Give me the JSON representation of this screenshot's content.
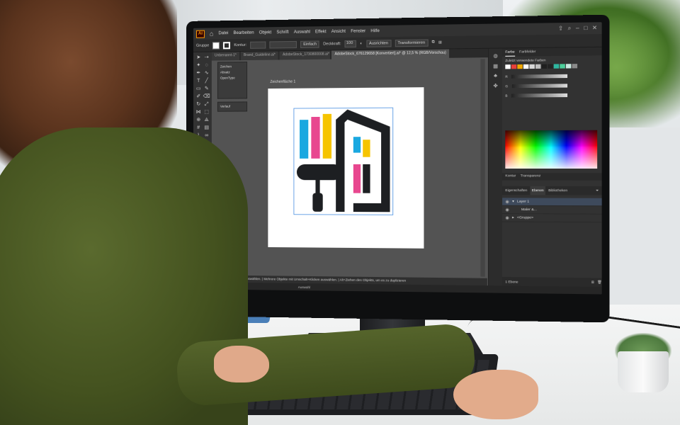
{
  "app": {
    "logo_text": "Ai",
    "menus": [
      "Datei",
      "Bearbeiten",
      "Objekt",
      "Schrift",
      "Auswahl",
      "Effekt",
      "Ansicht",
      "Fenster",
      "Hilfe"
    ]
  },
  "control_bar": {
    "selection_label": "Gruppe",
    "stroke_label": "Kontur:",
    "stroke_style": "Einfach",
    "opacity_label": "Deckkraft:",
    "opacity_value": "100",
    "align_button": "Ausrichten",
    "transform_button": "Transformieren"
  },
  "document_tabs": [
    {
      "label": "Unbenannt-1*",
      "active": false
    },
    {
      "label": "Brand_Guideline.ai*",
      "active": false
    },
    {
      "label": "AdobeStock_1730800008.ai*",
      "active": false
    },
    {
      "label": "AdobeStock_676129658 [Konvertiert].ai* @ 12,5 % (RGB/Vorschau)",
      "active": true
    }
  ],
  "float_panel": {
    "items": [
      "Zeichen",
      "Absatz",
      "OpenType"
    ],
    "extra": "Verlauf"
  },
  "artboard": {
    "label": "Zeichenfläche 1"
  },
  "color_panel": {
    "tabs": [
      "Farbe",
      "Farbfelder"
    ],
    "recent_label": "Zuletzt verwendete Farben",
    "recent_colors": [
      "#ffffff",
      "#e8403a",
      "#f0a800",
      "#ffffff",
      "#d7d7d7",
      "#bfbfbf",
      "#1f1f1f",
      "#222222",
      "#2fb7a0",
      "#4ccf9b",
      "#c9e8e0",
      "#8a8a8a"
    ],
    "slider_labels": [
      "R",
      "G",
      "B"
    ]
  },
  "stroke_tabs": [
    "Kontur",
    "Transparenz"
  ],
  "layers_panel": {
    "tabs": [
      "Eigenschaften",
      "Ebenen",
      "Bibliotheken"
    ],
    "active_tab": "Ebenen",
    "rows": [
      {
        "name": "Layer 1",
        "selected": true
      },
      {
        "name": "Maler &...",
        "selected": false
      },
      {
        "name": "<Gruppe>",
        "selected": false
      }
    ],
    "footer": "1 Ebene"
  },
  "status_bar": {
    "hint": "Objekt durch Klicken auswählen. | Mehrere Objekte mit Umschalt+Klicken auswählen. | Alt+Ziehen des Objekts, um es zu duplizieren",
    "zoom": "12,5%",
    "tool_label": "Auswahl"
  },
  "logo_colors": {
    "cyan": "#1aa8e0",
    "pink": "#e8478f",
    "yellow": "#f6c400",
    "dark": "#1d1f22"
  }
}
